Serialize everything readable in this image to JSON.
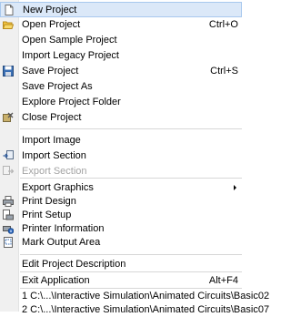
{
  "menu": {
    "new_project": {
      "label": "New Project",
      "icon": "new-document-icon"
    },
    "open_project": {
      "label": "Open Project",
      "shortcut": "Ctrl+O",
      "icon": "open-folder-icon"
    },
    "open_sample": {
      "label": "Open Sample Project"
    },
    "import_legacy": {
      "label": "Import Legacy Project"
    },
    "save_project": {
      "label": "Save Project",
      "shortcut": "Ctrl+S",
      "icon": "floppy-disk-icon"
    },
    "save_as": {
      "label": "Save Project As"
    },
    "explore_folder": {
      "label": "Explore Project Folder"
    },
    "close_project": {
      "label": "Close Project",
      "icon": "close-project-icon"
    },
    "import_image": {
      "label": "Import Image"
    },
    "import_section": {
      "label": "Import Section",
      "icon": "import-section-icon"
    },
    "export_section": {
      "label": "Export Section",
      "icon": "export-section-icon"
    },
    "export_graphics": {
      "label": "Export Graphics"
    },
    "print_design": {
      "label": "Print Design",
      "icon": "printer-icon"
    },
    "print_setup": {
      "label": "Print Setup",
      "icon": "print-setup-icon"
    },
    "printer_info": {
      "label": "Printer Information",
      "icon": "printer-info-icon"
    },
    "mark_output": {
      "label": "Mark Output Area",
      "icon": "mark-output-icon"
    },
    "edit_description": {
      "label": "Edit Project Description"
    },
    "exit_app": {
      "label": "Exit Application",
      "shortcut": "Alt+F4"
    },
    "recent1": {
      "label": "1 C:\\...\\Interactive Simulation\\Animated Circuits\\Basic02"
    },
    "recent2": {
      "label": "2 C:\\...\\Interactive Simulation\\Animated Circuits\\Basic07"
    }
  },
  "colors": {
    "selection_bg": "#dbe8f8",
    "selection_border": "#a8c8ee",
    "disabled_text": "#a3a3a3",
    "gutter": "#f0f0f0"
  }
}
